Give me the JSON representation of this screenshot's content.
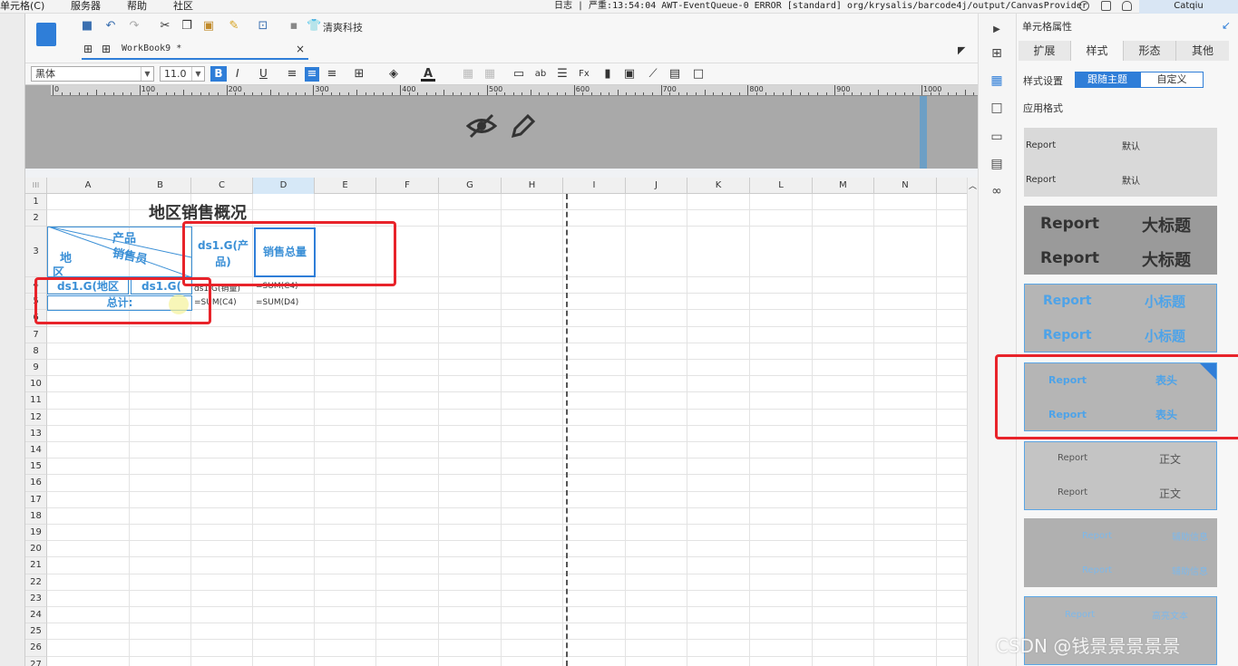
{
  "menu": [
    "单元格(C)",
    "服务器",
    "帮助",
    "社区"
  ],
  "log_text": "日志 | 严重:13:54:04 AWT-EventQueue-0 ERROR [standard] org/krysalis/barcode4j/output/CanvasProvider",
  "user": "Catqiu",
  "toolbar": {
    "brand_label": "清爽科技",
    "tab_title": "WorkBook9 *",
    "font_name": "黑体",
    "font_size": "11.0",
    "bold": "B",
    "italic": "I",
    "underline": "U"
  },
  "ruler": {
    "labels": [
      "0",
      "100",
      "200",
      "300",
      "400",
      "500",
      "600",
      "700",
      "800",
      "900",
      "1000"
    ]
  },
  "columns": [
    "A",
    "B",
    "C",
    "D",
    "E",
    "F",
    "G",
    "H",
    "I",
    "J",
    "K",
    "L",
    "M",
    "N"
  ],
  "rows": [
    "1",
    "2",
    "3",
    "4",
    "5",
    "6",
    "7",
    "8",
    "9",
    "10",
    "11",
    "12",
    "13",
    "14",
    "15",
    "16",
    "17",
    "18",
    "19",
    "20",
    "21",
    "22",
    "23",
    "24",
    "25",
    "26",
    "27"
  ],
  "cells": {
    "title": "地区销售概况",
    "header_product": "产品",
    "header_salesman": "销售员",
    "header_region_1": "地",
    "header_region_2": "区",
    "c3": "ds1.G(产品)",
    "d3": "销售总量",
    "a4": "ds1.G(地区",
    "b4": "ds1.G(",
    "c4": "ds1.G(销量)",
    "d4": "=SUM(C4)",
    "a5": "总计:",
    "c5": "=SUM(C4)",
    "d5": "=SUM(D4)"
  },
  "panel": {
    "title": "单元格属性",
    "tabs": [
      "扩展",
      "样式",
      "形态",
      "其他"
    ],
    "style_setting_label": "样式设置",
    "follow_theme": "跟随主题",
    "custom": "自定义",
    "apply_format": "应用格式",
    "swatches": [
      {
        "left": "Report",
        "right": "默认"
      },
      {
        "left": "Report",
        "right": "大标题"
      },
      {
        "left": "Report",
        "right": "小标题"
      },
      {
        "left": "Report",
        "right": "表头"
      },
      {
        "left": "Report",
        "right": "正文"
      },
      {
        "left": "Report",
        "right": "辅助信息"
      },
      {
        "left": "Report",
        "right": "高亮文本"
      }
    ]
  },
  "watermark": "CSDN @钱景景景景景",
  "colors": {
    "accent": "#2f7ed8",
    "cell_text": "#3a8fd6",
    "annotation": "#e8232a"
  }
}
